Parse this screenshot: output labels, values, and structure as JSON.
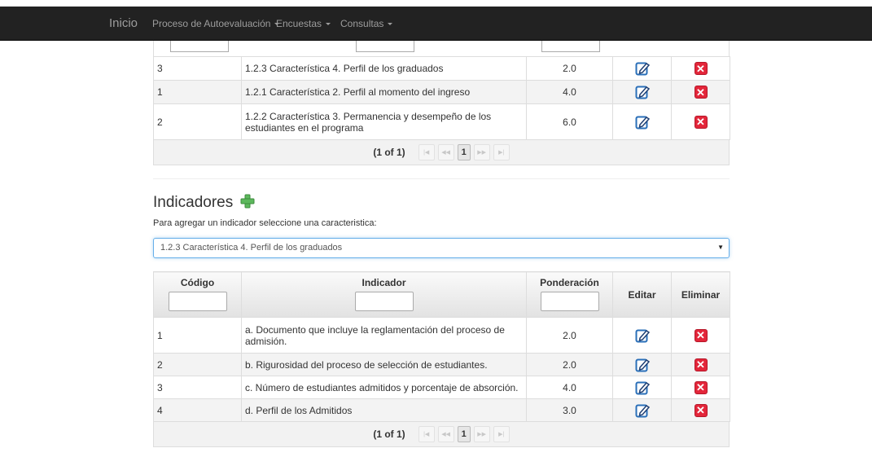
{
  "navbar": {
    "brand": "Inicio",
    "items": [
      {
        "label": "Proceso de Autoevaluación"
      },
      {
        "label": "Encuestas"
      },
      {
        "label": "Consultas"
      }
    ]
  },
  "caracteristicas_table": {
    "rows": [
      {
        "codigo": "3",
        "nombre": "1.2.3 Característica 4. Perfil de los graduados",
        "ponderacion": "2.0"
      },
      {
        "codigo": "1",
        "nombre": "1.2.1 Característica 2. Perfil al momento del ingreso",
        "ponderacion": "4.0"
      },
      {
        "codigo": "2",
        "nombre": "1.2.2 Característica 3. Permanencia y desempeño de los estudiantes en el programa",
        "ponderacion": "6.0"
      }
    ],
    "paginator": {
      "report": "(1 of 1)",
      "page": "1"
    }
  },
  "indicadores": {
    "title": "Indicadores",
    "hint": "Para agregar un indicador seleccione una caracteristica:",
    "select_value": "1.2.3 Característica 4. Perfil de los graduados",
    "headers": {
      "codigo": "Código",
      "indicador": "Indicador",
      "ponderacion": "Ponderación",
      "editar": "Editar",
      "eliminar": "Eliminar"
    },
    "rows": [
      {
        "codigo": "1",
        "indicador": "a. Documento que incluye la reglamentación del proceso de admisión.",
        "ponderacion": "2.0"
      },
      {
        "codigo": "2",
        "indicador": "b. Rigurosidad del proceso de selección de estudiantes.",
        "ponderacion": "2.0"
      },
      {
        "codigo": "3",
        "indicador": "c. Número de estudiantes admitidos y porcentaje de absorción.",
        "ponderacion": "4.0"
      },
      {
        "codigo": "4",
        "indicador": "d. Perfil de los Admitidos",
        "ponderacion": "3.0"
      }
    ],
    "paginator": {
      "report": "(1 of 1)",
      "page": "1"
    }
  },
  "colors": {
    "navbar_bg": "#222222",
    "delete_red": "#e3263a",
    "edit_blue": "#2a6fb8",
    "add_green": "#5cb85c",
    "select_focus": "#66afe9"
  },
  "icons": {
    "edit": "edit-icon",
    "delete": "delete-icon",
    "add": "plus-icon"
  }
}
